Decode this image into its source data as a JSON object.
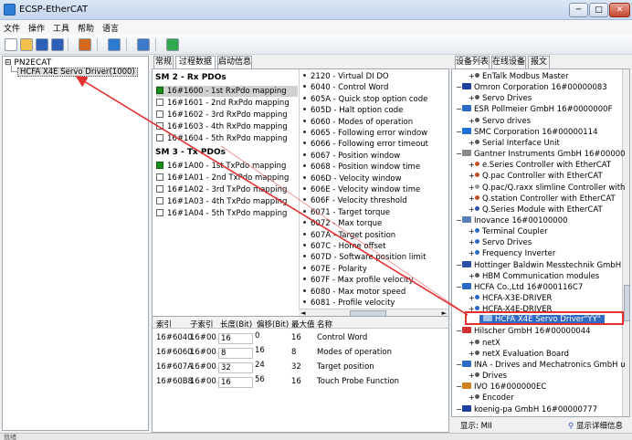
{
  "window": {
    "title": "ECSP-EtherCAT",
    "min_label": "─",
    "max_label": "□",
    "close_label": "✕"
  },
  "menu": [
    "文件",
    "操作",
    "工具",
    "帮助",
    "语言"
  ],
  "toolbar": {
    "icons": [
      "new-file-icon",
      "open-folder-icon",
      "save-icon",
      "save-all-icon",
      "settings-gear-icon",
      "network-icon",
      "list-config-icon",
      "refresh-icon"
    ],
    "colors": [
      "#ffffff",
      "#f2c14e",
      "#2b5fb8",
      "#2b5fb8",
      "#d4691e",
      "#2d7bd1",
      "#3b7bc8",
      "#2fa84f"
    ]
  },
  "left_tree": {
    "root": "PN2ECAT",
    "child": "HCFA X4E Servo Driver(1000)"
  },
  "center_tabs": [
    "常规",
    "过程数据",
    "启动信息"
  ],
  "sm2": {
    "title": "SM 2 - Rx PDOs",
    "items": [
      {
        "label": "16#1600 - 1st RxPdo mapping",
        "checked": true,
        "selected": true
      },
      {
        "label": "16#1601 - 2nd RxPdo mapping",
        "checked": false
      },
      {
        "label": "16#1602 - 3rd RxPdo mapping",
        "checked": false
      },
      {
        "label": "16#1603 - 4th RxPdo mapping",
        "checked": false
      },
      {
        "label": "16#1604 - 5th RxPdo mapping",
        "checked": false
      }
    ]
  },
  "sm3": {
    "title": "SM 3 - Tx PDOs",
    "items": [
      {
        "label": "16#1A00 - 1st TxPdo mapping",
        "checked": true
      },
      {
        "label": "16#1A01 - 2nd TxPdo mapping",
        "checked": false
      },
      {
        "label": "16#1A02 - 3rd TxPdo mapping",
        "checked": false
      },
      {
        "label": "16#1A03 - 4th TxPdo mapping",
        "checked": false
      },
      {
        "label": "16#1A04 - 5th TxPdo mapping",
        "checked": false
      }
    ]
  },
  "entries": [
    "2120 - Virtual DI DO",
    "6040 - Control Word",
    "605A - Quick stop option code",
    "605D - Halt option code",
    "6060 - Modes of operation",
    "6065 - Following error window",
    "6066 - Following error timeout",
    "6067 - Position window",
    "6068 - Position window time",
    "606D - Velocity window",
    "606E - Velocity window time",
    "606F - Velocity threshold",
    "6071 - Target torque",
    "6072 - Max torque",
    "607A - Target position",
    "607C - Home offset",
    "607D - Software position limit",
    "607E - Polarity",
    "607F - Max profile velocity",
    "6080 - Max motor speed",
    "6081 - Profile velocity"
  ],
  "scroll": {
    "left": "◄",
    "right": "►"
  },
  "grid": {
    "headers": [
      "索引",
      "子索引",
      "长度(Bit)",
      "偏移(Bit)",
      "最大值",
      "名称"
    ],
    "rows": [
      [
        "16#6040",
        "16#00",
        "16",
        "0",
        "16",
        "Control Word"
      ],
      [
        "16#6060",
        "16#00",
        "8",
        "16",
        "8",
        "Modes of operation"
      ],
      [
        "16#607A",
        "16#00",
        "32",
        "24",
        "32",
        "Target position"
      ],
      [
        "16#60B8",
        "16#00",
        "16",
        "56",
        "16",
        "Touch Probe Function"
      ]
    ]
  },
  "right_tabs": [
    "设备列表",
    "在线设备",
    "报文"
  ],
  "devices": [
    {
      "level": 1,
      "label": "EnTalk Modbus Master",
      "kind": "item",
      "color": "#555555"
    },
    {
      "level": 0,
      "label": "Omron Corporation   16#00000083",
      "kind": "vendor",
      "color": "#1e3f9e"
    },
    {
      "level": 1,
      "label": "Servo Drives",
      "kind": "item",
      "color": "#555555"
    },
    {
      "level": 0,
      "label": "ESR Pollmeier GmbH   16#0000000F",
      "kind": "vendor",
      "color": "#2a6ac4"
    },
    {
      "level": 1,
      "label": "Servo drives",
      "kind": "item",
      "color": "#555555"
    },
    {
      "level": 0,
      "label": "SMC Corporation   16#00000114",
      "kind": "vendor",
      "color": "#1f6fd6"
    },
    {
      "level": 1,
      "label": "Serial Interface Unit",
      "kind": "item",
      "color": "#555555"
    },
    {
      "level": 0,
      "label": "Gantner Instruments GmbH   16#00000",
      "kind": "vendor",
      "color": "#8a8a8a"
    },
    {
      "level": 1,
      "label": "e.Series Controller with EtherCAT",
      "kind": "item",
      "color": "#c05020"
    },
    {
      "level": 1,
      "label": "Q.pac Controller with EtherCAT",
      "kind": "item",
      "color": "#c05020"
    },
    {
      "level": 1,
      "label": "Q.pac/Q.raxx slimline Controller with",
      "kind": "item",
      "color": "#999999"
    },
    {
      "level": 1,
      "label": "Q.station Controller with EtherCAT",
      "kind": "item",
      "color": "#c05020"
    },
    {
      "level": 1,
      "label": "Q.Series Module with EtherCAT",
      "kind": "item",
      "color": "#2a4fa8"
    },
    {
      "level": 0,
      "label": "Inovance   16#00100000",
      "kind": "vendor",
      "color": "#5a7fb8"
    },
    {
      "level": 1,
      "label": "Terminal Coupler",
      "kind": "item",
      "color": "#2a6ac4"
    },
    {
      "level": 1,
      "label": "Servo Drives",
      "kind": "item",
      "color": "#2a6ac4"
    },
    {
      "level": 1,
      "label": "Frequency Inverter",
      "kind": "item",
      "color": "#2a6ac4"
    },
    {
      "level": 0,
      "label": "Hottinger Baldwin Messtechnik GmbH",
      "kind": "vendor",
      "color": "#2a4fa8"
    },
    {
      "level": 1,
      "label": "HBM Communication modules",
      "kind": "item",
      "color": "#555555"
    },
    {
      "level": 0,
      "label": "HCFA Co.,Ltd   16#000116C7",
      "kind": "vendor",
      "color": "#2a6ac4"
    },
    {
      "level": 1,
      "label": "HCFA-X3E-DRIVER",
      "kind": "item",
      "color": "#2a6ac4"
    },
    {
      "level": 1,
      "label": "HCFA-X4E-DRIVER",
      "kind": "item",
      "color": "#2a6ac4"
    },
    {
      "level": 2,
      "label": "HCFA X4E Servo Driver\"YY\"",
      "kind": "selected",
      "color": "#ffffff"
    },
    {
      "level": 0,
      "label": "Hilscher GmbH   16#00000044",
      "kind": "vendor",
      "color": "#d03030"
    },
    {
      "level": 1,
      "label": "netX",
      "kind": "item",
      "color": "#555555"
    },
    {
      "level": 1,
      "label": "netX Evaluation Board",
      "kind": "item",
      "color": "#555555"
    },
    {
      "level": 0,
      "label": "INA - Drives and Mechatronics GmbH u",
      "kind": "vendor",
      "color": "#2a6ac4"
    },
    {
      "level": 1,
      "label": "Drives",
      "kind": "item",
      "color": "#555555"
    },
    {
      "level": 0,
      "label": "IVO   16#000000EC",
      "kind": "vendor",
      "color": "#d08020"
    },
    {
      "level": 1,
      "label": "Encoder",
      "kind": "item",
      "color": "#555555"
    },
    {
      "level": 0,
      "label": "koenig-pa GmbH   16#00000777",
      "kind": "vendor",
      "color": "#1e3f9e"
    }
  ],
  "right_footer": {
    "show": "显示: MII",
    "detail": "显示详细信息"
  },
  "statusbar": {
    "text": "就绪"
  },
  "colors": {
    "highlight": "#e53030",
    "selection": "#316ac5",
    "arrow": "#e53030"
  }
}
